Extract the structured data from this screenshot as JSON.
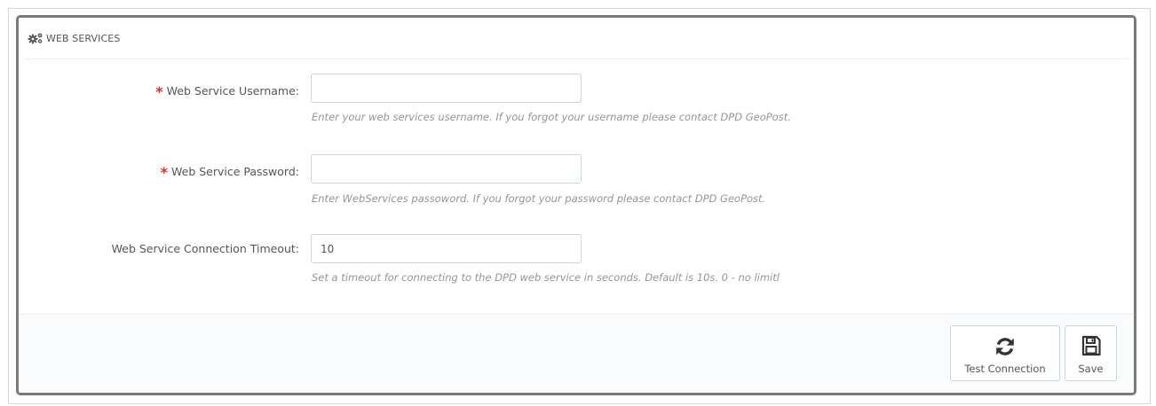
{
  "panel": {
    "title": "WEB SERVICES",
    "title_icon": "cogs-icon"
  },
  "form": {
    "required_marker": "*",
    "username": {
      "label": "Web Service Username:",
      "value": "",
      "help": "Enter your web services username. If you forgot your username please contact DPD GeoPost."
    },
    "password": {
      "label": "Web Service Password:",
      "value": "",
      "help": "Enter WebServices passoword. If you forgot your password please contact DPD GeoPost."
    },
    "timeout": {
      "label": "Web Service Connection Timeout:",
      "value": "10",
      "help": "Set a timeout for connecting to the DPD web service in seconds. Default is 10s. 0 - no limitl"
    }
  },
  "footer": {
    "test_label": "Test Connection",
    "test_icon": "refresh-icon",
    "save_label": "Save",
    "save_icon": "floppy-disk-icon"
  },
  "colors": {
    "required": "#e32b2b",
    "panel_border": "#7a7a7a",
    "input_border": "#c7d6db",
    "help_text": "#959595"
  }
}
